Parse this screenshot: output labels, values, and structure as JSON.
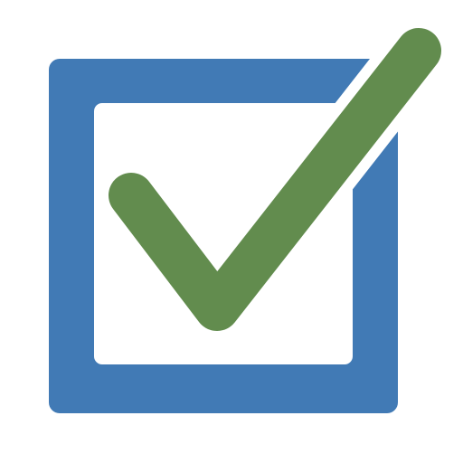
{
  "icon": {
    "name": "checkbox-checked-icon",
    "state": "checked",
    "colors": {
      "background": "#ffffff",
      "box": "#417ab5",
      "box_inner": "#ffffff",
      "checkmark": "#628c4e",
      "checkmark_gap": "#ffffff"
    }
  }
}
